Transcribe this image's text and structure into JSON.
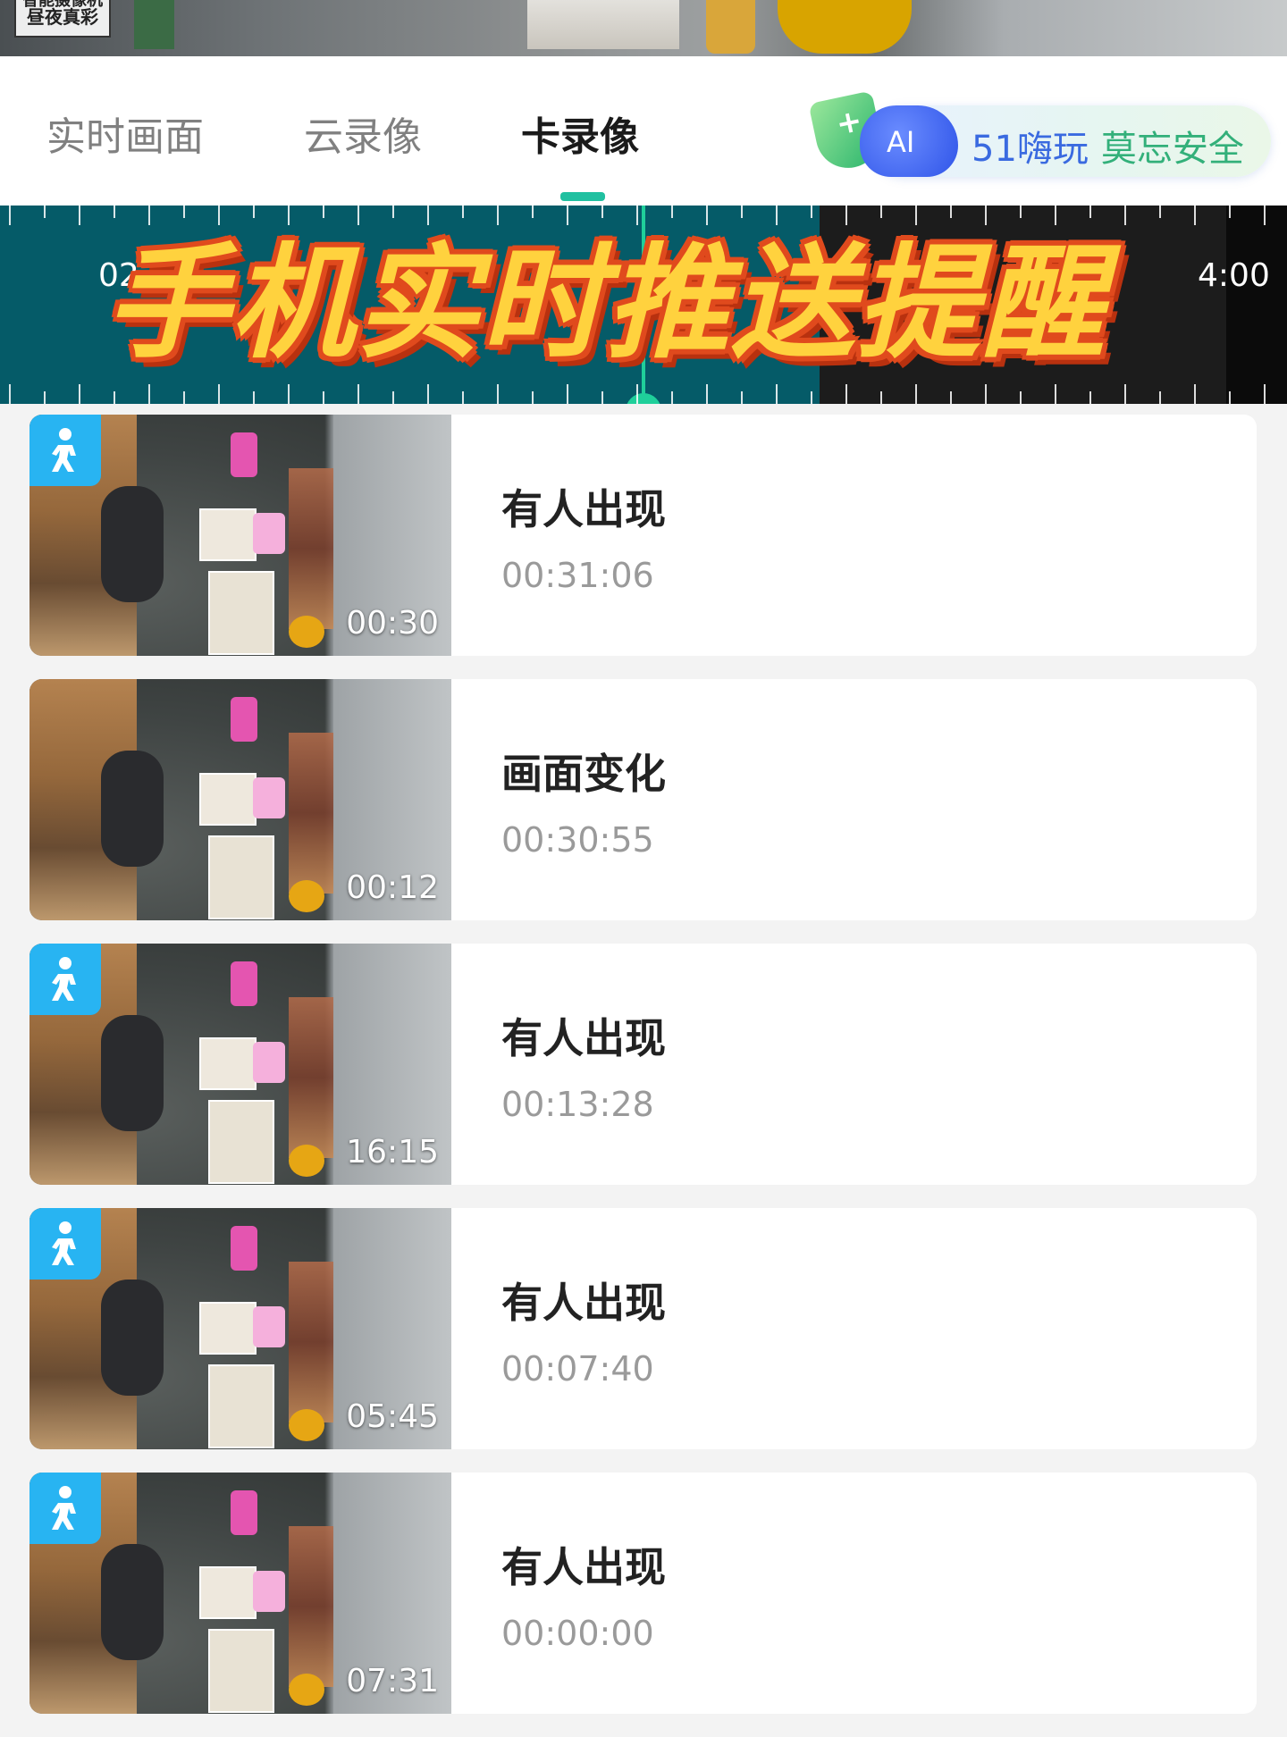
{
  "camera_strip": {
    "label_line1": "智能摄像机",
    "label_line2": "昼夜真彩"
  },
  "tabs": [
    {
      "label": "实时画面",
      "active": false
    },
    {
      "label": "云录像",
      "active": false
    },
    {
      "label": "卡录像",
      "active": true
    }
  ],
  "ai_badge": {
    "shield_symbol": "+",
    "cloud_text": "AI",
    "text_a": "51嗨玩",
    "text_b": "莫忘安全"
  },
  "timeline": {
    "left_label": "02",
    "right_label": "4:00"
  },
  "banner": "手机实时推送提醒",
  "events": [
    {
      "title": "有人出现",
      "time": "00:31:06",
      "duration": "00:30",
      "icon": "person-walking-icon",
      "show_badge": true
    },
    {
      "title": "画面变化",
      "time": "00:30:55",
      "duration": "00:12",
      "icon": "",
      "show_badge": false
    },
    {
      "title": "有人出现",
      "time": "00:13:28",
      "duration": "16:15",
      "icon": "person-walking-icon",
      "show_badge": true
    },
    {
      "title": "有人出现",
      "time": "00:07:40",
      "duration": "05:45",
      "icon": "person-walking-icon",
      "show_badge": true
    },
    {
      "title": "有人出现",
      "time": "00:00:00",
      "duration": "07:31",
      "icon": "person-walking-icon",
      "show_badge": true
    }
  ],
  "colors": {
    "accent": "#20c0a0",
    "timeline_recorded": "#055b68",
    "badge_blue": "#28b4f2",
    "banner_fill": "#ffd23e",
    "banner_stroke": "#e04a1d"
  }
}
